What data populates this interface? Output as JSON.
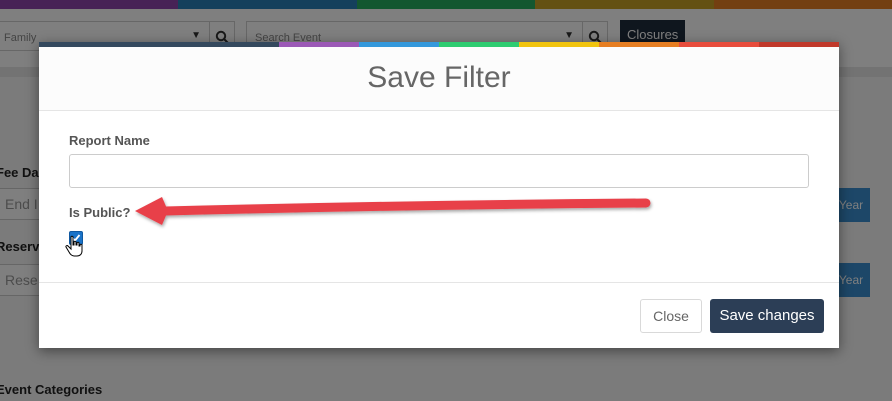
{
  "background": {
    "color_bar": [
      "#8e44ad",
      "#2980b9",
      "#27ae60",
      "#c9a227",
      "#e67e22",
      "#d35400"
    ],
    "family_select": {
      "value": "Family"
    },
    "event_select": {
      "value": "Search Event"
    },
    "closures_button": "Closures",
    "fee_date_label": "Fee Da",
    "end_input_placeholder": "End I",
    "reservation_label": "Reserv",
    "reservation_input_placeholder": "Rese",
    "year_button_1": "Year",
    "year_button_2": "Year",
    "event_categories_label": "Event Categories"
  },
  "modal": {
    "top_bar": [
      "#34495e",
      "#34495e",
      "#34495e",
      "#9b59b6",
      "#3498db",
      "#2ecc71",
      "#f1c40f",
      "#e67e22",
      "#e74c3c",
      "#c0392b"
    ],
    "title": "Save Filter",
    "report_name_label": "Report Name",
    "report_name_value": "",
    "is_public_label": "Is Public?",
    "is_public_checked": true,
    "close_button": "Close",
    "save_button": "Save changes"
  },
  "annotation": {
    "arrow_color": "#e8404a"
  }
}
